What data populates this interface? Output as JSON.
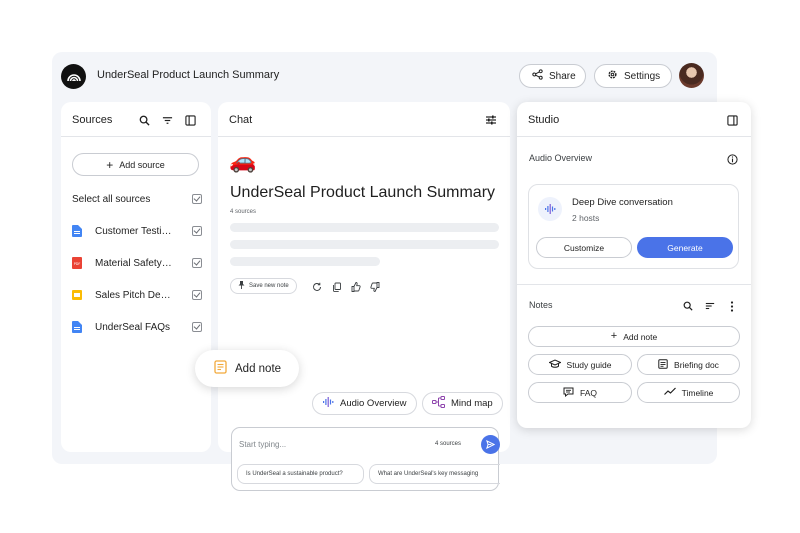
{
  "header": {
    "title": "UnderSeal Product Launch Summary",
    "share_label": "Share",
    "settings_label": "Settings"
  },
  "sources": {
    "title": "Sources",
    "add_source_label": "Add source",
    "select_all_label": "Select all sources",
    "items": [
      {
        "label": "Customer Testi…",
        "icon": "doc-icon",
        "color": "#4285f4"
      },
      {
        "label": "Material Safety…",
        "icon": "pdf-icon",
        "color": "#ea4335"
      },
      {
        "label": "Sales Pitch De…",
        "icon": "slides-icon",
        "color": "#fbbc04"
      },
      {
        "label": "UnderSeal FAQs",
        "icon": "doc-icon",
        "color": "#4285f4"
      }
    ]
  },
  "chat": {
    "title": "Chat",
    "emoji": "🚗",
    "notebook_title": "UnderSeal Product Launch Summary",
    "source_count": "4 sources",
    "save_note_label": "Save new note",
    "chips": {
      "audio_overview": "Audio Overview",
      "mind_map": "Mind map"
    },
    "input_placeholder": "Start typing...",
    "input_source_count": "4 sources",
    "suggestions": [
      "Is UnderSeal a sustainable product?",
      "What are UnderSeal's key messaging"
    ],
    "add_note_popup": "Add note"
  },
  "studio": {
    "title": "Studio",
    "audio_overview_label": "Audio Overview",
    "audio_card": {
      "title": "Deep Dive conversation",
      "subtitle": "2 hosts",
      "customize_label": "Customize",
      "generate_label": "Generate"
    },
    "notes_label": "Notes",
    "add_note_label": "Add note",
    "note_buttons": {
      "study_guide": "Study guide",
      "briefing_doc": "Briefing doc",
      "faq": "FAQ",
      "timeline": "Timeline"
    }
  },
  "colors": {
    "accent": "#4a73e8",
    "app_bg": "#f3f5f9"
  }
}
